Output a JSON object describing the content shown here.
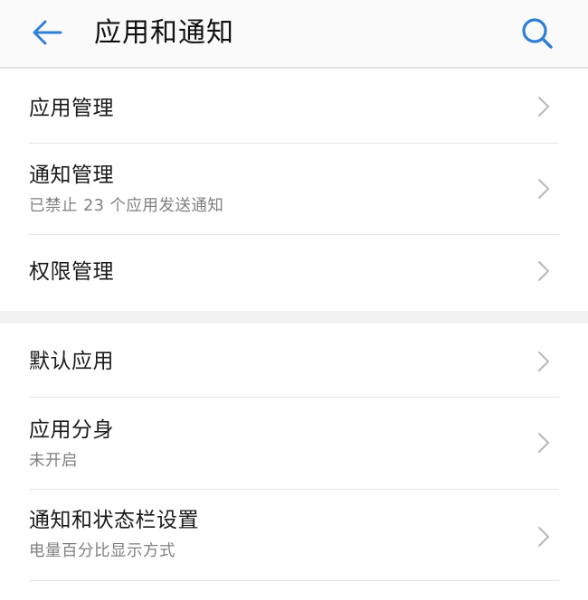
{
  "header": {
    "title": "应用和通知",
    "back_icon": "arrow-left-icon",
    "search_icon": "search-icon",
    "accent_color": "#2f7fd6"
  },
  "settings_groups": [
    {
      "items": [
        {
          "label": "应用管理",
          "subtitle": ""
        },
        {
          "label": "通知管理",
          "subtitle": "已禁止 23 个应用发送通知"
        },
        {
          "label": "权限管理",
          "subtitle": ""
        }
      ]
    },
    {
      "items": [
        {
          "label": "默认应用",
          "subtitle": ""
        },
        {
          "label": "应用分身",
          "subtitle": "未开启"
        },
        {
          "label": "通知和状态栏设置",
          "subtitle": "电量百分比显示方式"
        }
      ]
    }
  ],
  "chevron_icon": "chevron-right-icon"
}
